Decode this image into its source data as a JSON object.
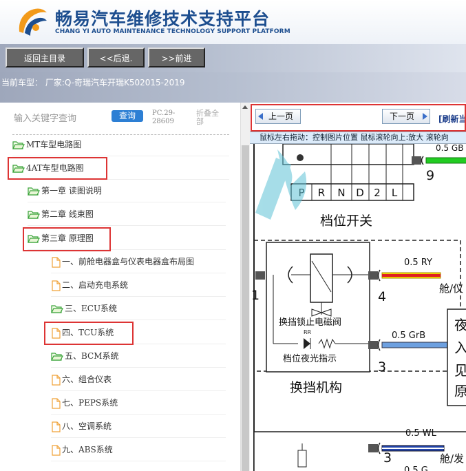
{
  "header": {
    "title": "畅易汽车维修技术支持平台",
    "subtitle": "CHANG YI AUTO MAINTENANCE TECHNOLOGY SUPPORT PLATFORM"
  },
  "toolbar": {
    "home_label": "返回主目录",
    "back_label": "<<后退.",
    "forward_label": ">>前进"
  },
  "vehicle": {
    "text": "当前车型： 厂家:Q-奇瑞汽车开瑞K502015-2019"
  },
  "search": {
    "placeholder": "输入关键字查询",
    "button_label": "查询",
    "pc_info": "PC.29-28609",
    "collapse_label": "折叠全部"
  },
  "tree": {
    "items": [
      {
        "label": "MT车型电路图",
        "icon": "folder-open-icon"
      },
      {
        "label": "4AT车型电路图",
        "icon": "folder-open-icon"
      },
      {
        "label": "第一章 读图说明",
        "icon": "folder-open-icon"
      },
      {
        "label": "第二章 线束图",
        "icon": "folder-open-icon"
      },
      {
        "label": "第三章 原理图",
        "icon": "folder-open-icon"
      },
      {
        "label": "一、前舱电器盒与仪表电器盒布局图",
        "icon": "document-icon"
      },
      {
        "label": "二、启动充电系统",
        "icon": "document-icon"
      },
      {
        "label": "三、ECU系统",
        "icon": "folder-open-icon"
      },
      {
        "label": "四、TCU系统",
        "icon": "document-icon"
      },
      {
        "label": "五、BCM系统",
        "icon": "folder-open-icon"
      },
      {
        "label": "六、组合仪表",
        "icon": "document-icon"
      },
      {
        "label": "七、PEPS系统",
        "icon": "document-icon"
      },
      {
        "label": "八、空调系统",
        "icon": "document-icon"
      },
      {
        "label": "九、ABS系统",
        "icon": "document-icon"
      }
    ]
  },
  "viewer": {
    "prev_label": "上一页",
    "next_label": "下一页",
    "refresh_label": "[刷新当",
    "hint": "鼠标左右拖动：控制图片位置  鼠标滚轮向上:放大  滚轮向"
  },
  "diagram": {
    "top_wire_label": "0.5 GB",
    "pin_9": "9",
    "gears": [
      "P",
      "R",
      "N",
      "D",
      "2",
      "L"
    ],
    "gear_switch_label": "档位开关",
    "wire1_label": "0.5 RY",
    "wire1_dest": "舱/仪",
    "pin_1": "1",
    "pin_4": "4",
    "solenoid_label": "换挡锁止电磁阀",
    "rr_label": "RR",
    "wire2_label": "0.5 GrB",
    "night_light_label": "档位夜光指示",
    "pin_3": "3",
    "mechanism_label": "换挡机构",
    "side_box_chars": [
      "夜",
      "入",
      "见",
      "原"
    ],
    "wire3_label": "0.5 WL",
    "wire3_dest": "舱/发",
    "pin_3b": "3",
    "wire4_label": "0.5 G"
  },
  "colors": {
    "brand_blue": "#1d4e8f",
    "highlight_red": "#dd3434",
    "query_blue": "#2d7fd4",
    "wire_green": "#22cc22",
    "wire_red": "#e02020",
    "wire_yellow": "#f5e000",
    "wire_blue": "#6da0e0"
  }
}
